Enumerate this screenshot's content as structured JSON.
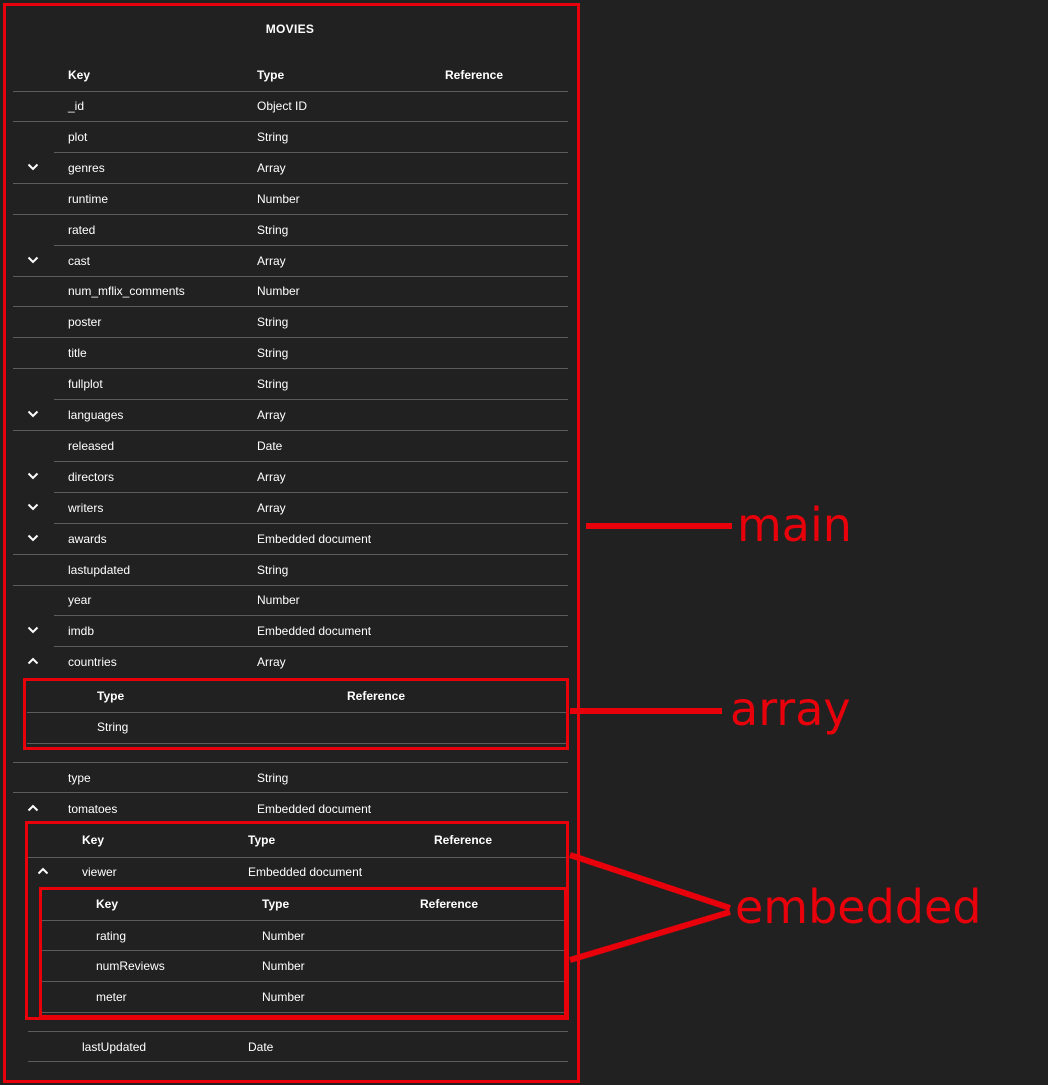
{
  "title": "MOVIES",
  "columns": {
    "key": "Key",
    "type": "Type",
    "reference": "Reference"
  },
  "rows": [
    {
      "key": "_id",
      "type": "Object ID"
    },
    {
      "key": "plot",
      "type": "String"
    },
    {
      "key": "genres",
      "type": "Array",
      "toggle": "collapsed"
    },
    {
      "key": "runtime",
      "type": "Number"
    },
    {
      "key": "rated",
      "type": "String"
    },
    {
      "key": "cast",
      "type": "Array",
      "toggle": "collapsed"
    },
    {
      "key": "num_mflix_comments",
      "type": "Number"
    },
    {
      "key": "poster",
      "type": "String"
    },
    {
      "key": "title",
      "type": "String"
    },
    {
      "key": "fullplot",
      "type": "String"
    },
    {
      "key": "languages",
      "type": "Array",
      "toggle": "collapsed"
    },
    {
      "key": "released",
      "type": "Date"
    },
    {
      "key": "directors",
      "type": "Array",
      "toggle": "collapsed"
    },
    {
      "key": "writers",
      "type": "Array",
      "toggle": "collapsed"
    },
    {
      "key": "awards",
      "type": "Embedded document",
      "toggle": "collapsed"
    },
    {
      "key": "lastupdated",
      "type": "String"
    },
    {
      "key": "year",
      "type": "Number"
    },
    {
      "key": "imdb",
      "type": "Embedded document",
      "toggle": "collapsed"
    },
    {
      "key": "countries",
      "type": "Array",
      "toggle": "expanded"
    }
  ],
  "countries_table": {
    "columns": {
      "type": "Type",
      "reference": "Reference"
    },
    "rows": [
      {
        "type": "String"
      }
    ]
  },
  "rows_after": [
    {
      "key": "type",
      "type": "String"
    },
    {
      "key": "tomatoes",
      "type": "Embedded document",
      "toggle": "expanded"
    }
  ],
  "tomatoes_table": {
    "columns": {
      "key": "Key",
      "type": "Type",
      "reference": "Reference"
    },
    "viewer_row": {
      "key": "viewer",
      "type": "Embedded document",
      "toggle": "expanded"
    },
    "viewer_table": {
      "columns": {
        "key": "Key",
        "type": "Type",
        "reference": "Reference"
      },
      "rows": [
        {
          "key": "rating",
          "type": "Number"
        },
        {
          "key": "numReviews",
          "type": "Number"
        },
        {
          "key": "meter",
          "type": "Number"
        }
      ]
    },
    "after_rows": [
      {
        "key": "lastUpdated",
        "type": "Date"
      }
    ]
  },
  "annotations": {
    "main": "main",
    "array": "array",
    "embedded": "embedded"
  },
  "colors": {
    "background": "#212121",
    "divider": "#5c5c5c",
    "annotation": "#e8000b",
    "text": "#ffffff"
  },
  "icons": {
    "collapsed": "chevron-down-icon",
    "expanded": "chevron-up-icon"
  }
}
